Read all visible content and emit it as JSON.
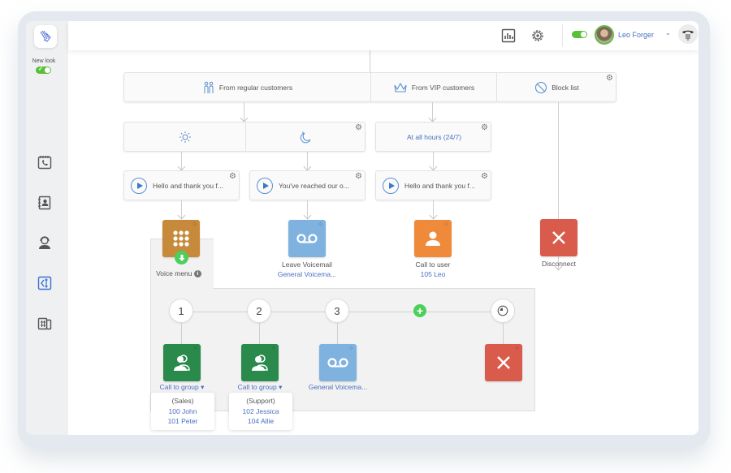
{
  "sidebar": {
    "new_look_label": "New look",
    "items": [
      {
        "icon": "call-history-icon"
      },
      {
        "icon": "contacts-icon"
      },
      {
        "icon": "operator-icon"
      },
      {
        "icon": "call-flow-icon",
        "active": true
      },
      {
        "icon": "numbers-devices-icon"
      }
    ]
  },
  "topbar": {
    "user_name": "Leo Forger",
    "chevron": "⌄"
  },
  "flow": {
    "sources": [
      {
        "label": "From regular customers",
        "icon": "people-icon"
      },
      {
        "label": "From VIP customers",
        "icon": "crown-icon"
      },
      {
        "label": "Block list",
        "icon": "block-icon"
      }
    ],
    "schedules": {
      "regular_day_icon": "sun-icon",
      "regular_night_icon": "moon-icon",
      "vip": "At all hours (24/7)"
    },
    "messages": [
      "Hello and thank you f...",
      "You've reached our o...",
      "Hello and thank you f..."
    ],
    "actions": {
      "voice_menu": {
        "label": "Voice menu",
        "color": "#c68a3a"
      },
      "leave_voicemail": {
        "label": "Leave Voicemail",
        "sub": "General Voicema...",
        "color": "#7fb2df"
      },
      "call_to_user": {
        "label": "Call to user",
        "sub": "105 Leo",
        "color": "#ef8a3b"
      },
      "disconnect": {
        "label": "Disconnect",
        "color": "#d95b4c"
      }
    },
    "menu_options": [
      {
        "key": "1",
        "action": "Call to group",
        "popup": {
          "title": "(Sales)",
          "members": [
            "100 John",
            "101 Peter"
          ]
        },
        "color": "#2a8a4c"
      },
      {
        "key": "2",
        "action": "Call to group",
        "popup": {
          "title": "(Support)",
          "members": [
            "102 Jessica",
            "104 Allie"
          ]
        },
        "color": "#2a8a4c"
      },
      {
        "key": "3",
        "action": "General Voicema...",
        "color": "#7fb2df"
      },
      {
        "key": "timeout",
        "action": "",
        "color": "#d95b4c"
      }
    ],
    "dropdown_caret": "▾",
    "gear": "⚙",
    "node_dots": "⁘",
    "plus": "+",
    "close": "✕"
  }
}
